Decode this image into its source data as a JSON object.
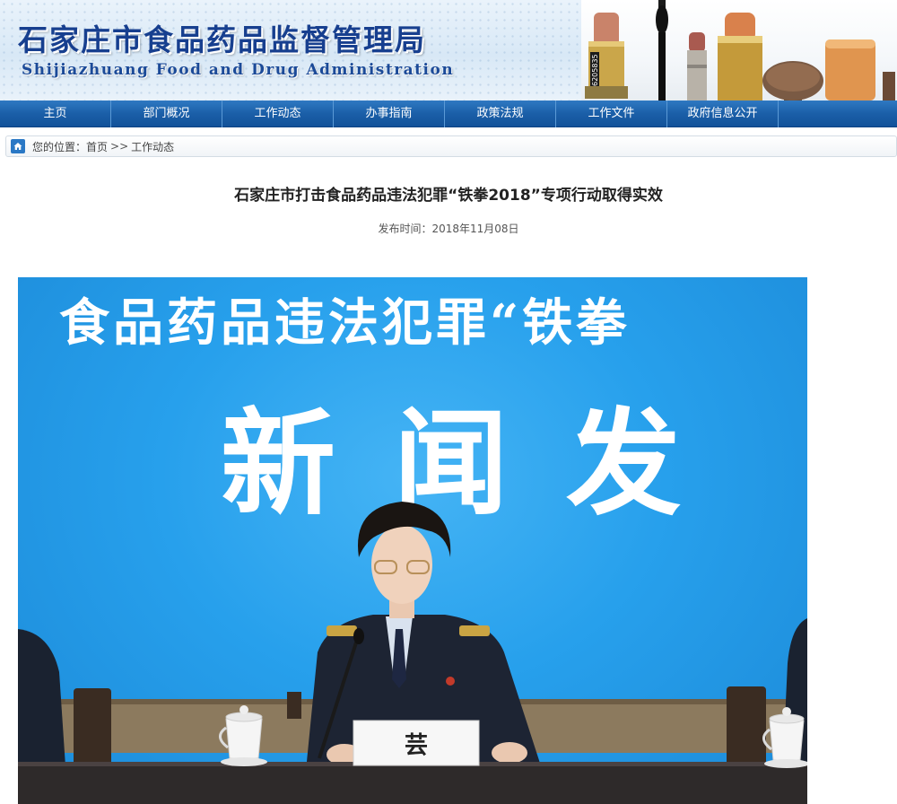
{
  "site": {
    "title_cn": "石家庄市食品药品监督管理局",
    "title_en": "Shijiazhuang Food and Drug Administration",
    "header_product_text": "6205835"
  },
  "nav": {
    "items": [
      {
        "label": "主页"
      },
      {
        "label": "部门概况"
      },
      {
        "label": "工作动态"
      },
      {
        "label": "办事指南"
      },
      {
        "label": "政策法规"
      },
      {
        "label": "工作文件"
      },
      {
        "label": "政府信息公开"
      }
    ]
  },
  "breadcrumb": {
    "prefix": "您的位置：",
    "home": "首页",
    "separator": ">>",
    "current": "工作动态"
  },
  "article": {
    "title": "石家庄市打击食品药品违法犯罪“铁拳2018”专项行动取得实效",
    "publish_label": "发布时间：",
    "publish_date": "2018年11月08日"
  },
  "photo": {
    "backdrop_line1": "食品药品违法犯罪“铁拳",
    "backdrop_line2": "新 闻 发",
    "nameplate_text": "芸"
  },
  "colors": {
    "nav_blue": "#1b5fa8",
    "header_title": "#173f8f",
    "backdrop_blue": "#27a0ec"
  },
  "icons": {
    "breadcrumb_home": "home-icon"
  }
}
